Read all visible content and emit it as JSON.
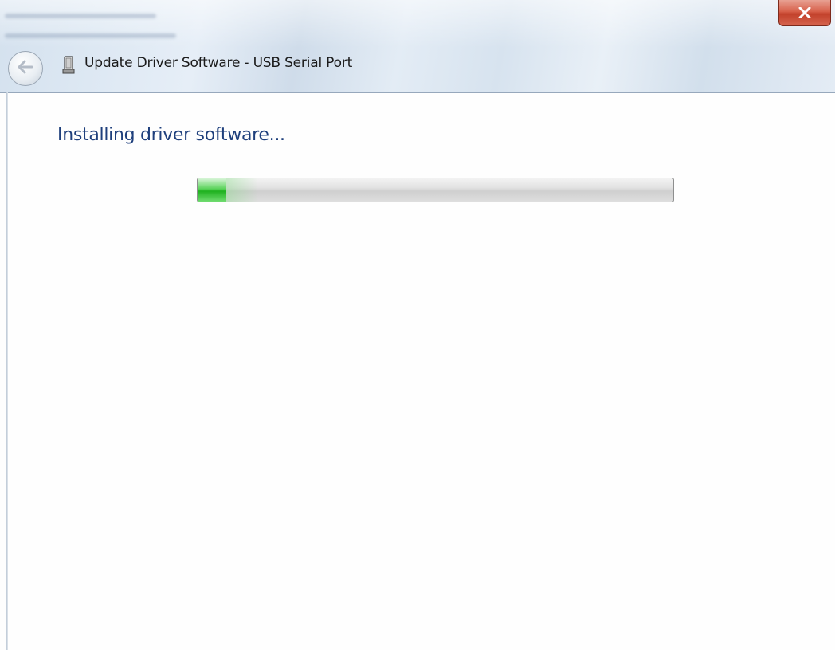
{
  "window": {
    "title": "Update Driver Software - USB Serial Port",
    "close_label": "X"
  },
  "content": {
    "heading": "Installing driver software..."
  },
  "progress": {
    "fraction": 0.06
  },
  "icons": {
    "back": "back-arrow-icon",
    "device": "usb-device-icon",
    "close": "close-icon"
  },
  "colors": {
    "heading": "#1e3f7c",
    "progress_fill": "#1fb11f",
    "close_button": "#c9452e"
  }
}
